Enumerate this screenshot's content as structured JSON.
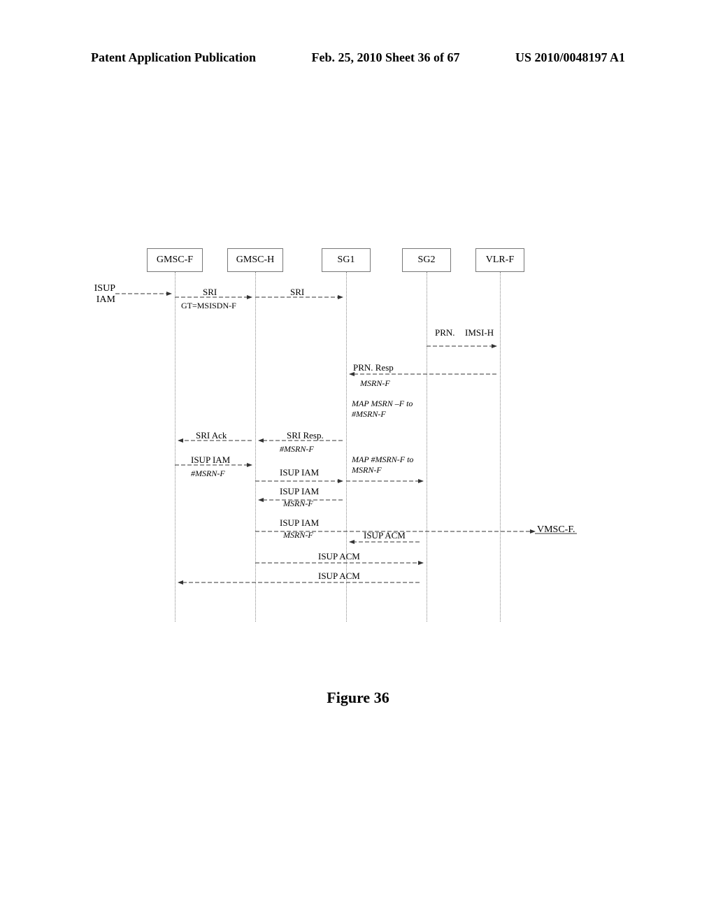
{
  "header": {
    "left": "Patent Application Publication",
    "center": "Feb. 25, 2010  Sheet 36 of 67",
    "right": "US 2010/0048197 A1"
  },
  "nodes": {
    "gmscf": "GMSC-F",
    "gmsch": "GMSC-H",
    "sg1": "SG1",
    "sg2": "SG2",
    "vlrf": "VLR-F"
  },
  "external": {
    "initiator": "ISUP IAM",
    "vmscf": "VMSC-F."
  },
  "labels": {
    "sri1": "SRI",
    "gt": "GT=MSISDN-F",
    "sri2": "SRI",
    "prn": "PRN.",
    "imsih": "IMSI-H",
    "prnresp": "PRN. Resp",
    "msrnf1": "MSRN-F",
    "map1": "MAP MSRN –F to #MSRN-F",
    "sriack": "SRI Ack",
    "sriresp": "SRI Resp.",
    "hmsrnf1": "#MSRN-F",
    "isupiam1": "ISUP IAM",
    "hmsrnf2": "#MSRN-F",
    "isupiam2": "ISUP IAM",
    "map2": "MAP #MSRN-F to MSRN-F",
    "isupiam3": "ISUP IAM",
    "msrnf2": "MSRN-F",
    "isupiam4": "ISUP IAM",
    "msrnf3": "MSRN-F",
    "isupacm1": "ISUP ACM",
    "isupacm2": "ISUP ACM",
    "isupacm3": "ISUP ACM"
  },
  "figure_caption": "Figure 36"
}
